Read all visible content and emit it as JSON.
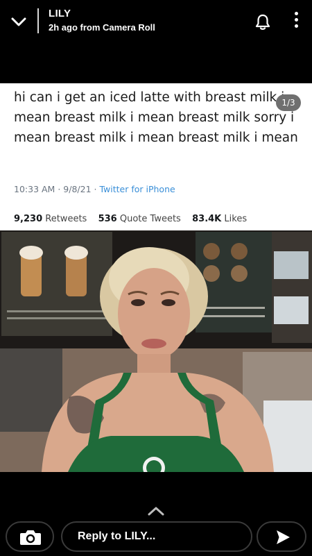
{
  "header": {
    "user_name": "LILY",
    "subtitle": "2h ago from Camera Roll",
    "icons": [
      "chevron-down-icon",
      "bell-icon",
      "more-vertical-icon"
    ]
  },
  "story": {
    "pager": "1/3",
    "tweet": {
      "text": "hi can i get an iced latte with breast milk i mean breast milk i mean breast milk sorry i mean breast milk i mean breast milk i mean",
      "time": "10:33 AM",
      "date": "9/8/21",
      "source": "Twitter for iPhone",
      "retweets_count": "9,230",
      "retweets_label": "Retweets",
      "quote_count": "536",
      "quote_label": "Quote Tweets",
      "likes_count": "83.4K",
      "likes_label": "Likes"
    }
  },
  "footer": {
    "reply_placeholder": "Reply to LILY...",
    "icons": [
      "camera-icon",
      "send-icon",
      "chevron-up-icon"
    ]
  },
  "colors": {
    "background": "#000000",
    "tweet_source": "#3a8fd8",
    "apron": "#1f6b3a"
  }
}
